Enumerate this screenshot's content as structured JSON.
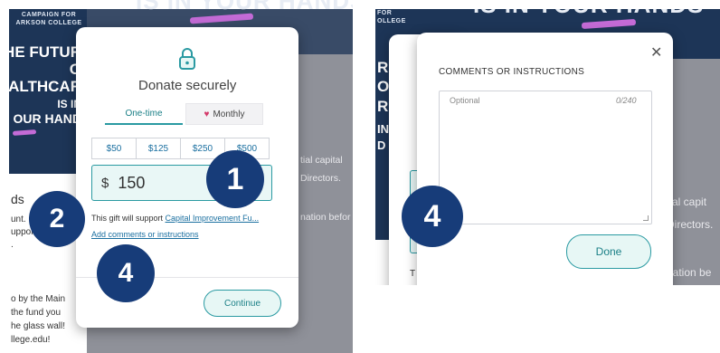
{
  "left": {
    "hero": {
      "campaign_line1": "CAMPAIGN FOR",
      "campaign_line2": "ARKSON COLLEGE",
      "big_lines": [
        "HE FUTUR",
        "O",
        "ALTHCAR",
        "IS IN",
        "OUR HAND"
      ],
      "headline": "IS IN YOUR HANDS"
    },
    "side": {
      "title": "ds",
      "lines": [
        "unt. C",
        "uppor",
        ".",
        "o by the Main",
        "the fund you",
        "he glass wall!",
        "llege.edu!"
      ]
    },
    "background_text": [
      "tial capital",
      "Directors.",
      "nation befor"
    ],
    "modal": {
      "title": "Donate securely",
      "tabs": [
        {
          "label": "One-time",
          "active": true
        },
        {
          "label": "Monthly",
          "active": false
        }
      ],
      "amounts": [
        "$50",
        "$125",
        "$250",
        "$500"
      ],
      "amount_input": {
        "currency": "$",
        "value": "150"
      },
      "support_text": "This gift will support ",
      "support_link": "Capital Improvement Fu...",
      "add_comments": "Add comments or instructions",
      "continue_label": "Continue"
    },
    "badges": [
      "1",
      "2",
      "4"
    ]
  },
  "right": {
    "hero": {
      "campaign_line1": "FOR",
      "campaign_line2": "OLLEGE",
      "headline": "IS IN YOUR HANDS",
      "side_letters": [
        "R",
        "O",
        "R",
        "IN",
        "D"
      ]
    },
    "background_text": [
      "tial capit",
      "Directors.",
      "nation be"
    ],
    "back_char": "T",
    "dialog": {
      "title": "COMMENTS OR INSTRUCTIONS",
      "placeholder": "Optional",
      "counter": "0/240",
      "done_label": "Done"
    },
    "badge": "4"
  },
  "colors": {
    "navy": "#1d3557",
    "teal": "#2a9aa2",
    "badge": "#173c79",
    "link": "#1a6fa0",
    "overlay_gray": "#8f9199"
  }
}
